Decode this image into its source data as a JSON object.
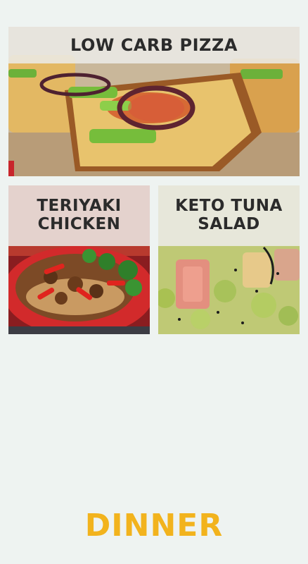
{
  "recipes": [
    {
      "title": "LOW CARB PIZZA"
    },
    {
      "title": "TERIYAKI\nCHICKEN"
    },
    {
      "title": "KETO TUNA\nSALAD"
    }
  ],
  "footer": {
    "title": "DINNER"
  },
  "colors": {
    "background": "#eef3f1",
    "accent": "#f2b31d",
    "title_text": "#2b2b2b"
  }
}
